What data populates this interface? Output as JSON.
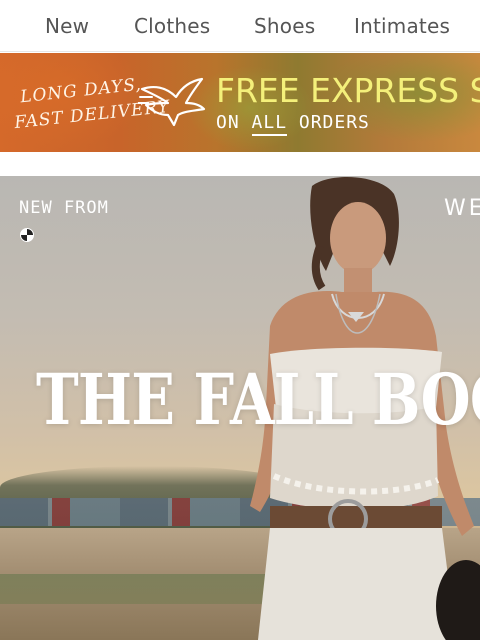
{
  "nav": {
    "items": [
      {
        "label": "New"
      },
      {
        "label": "Clothes"
      },
      {
        "label": "Shoes"
      },
      {
        "label": "Intimates"
      }
    ]
  },
  "promo": {
    "handwritten_line1": "LONG DAYS,",
    "handwritten_line2": "FAST DELIVERY",
    "headline": "FREE EXPRESS S",
    "sub_prefix": "ON ",
    "sub_emphasis": "ALL",
    "sub_suffix": " ORDERS",
    "icon": "bird-icon",
    "colors": {
      "headline": "#f4f07a",
      "background": "#c8642a"
    }
  },
  "hero": {
    "eyebrow": "NEW FROM",
    "eyebrow_right": "WE",
    "title": "THE FALL BOOT E",
    "icon": "loading-icon"
  }
}
